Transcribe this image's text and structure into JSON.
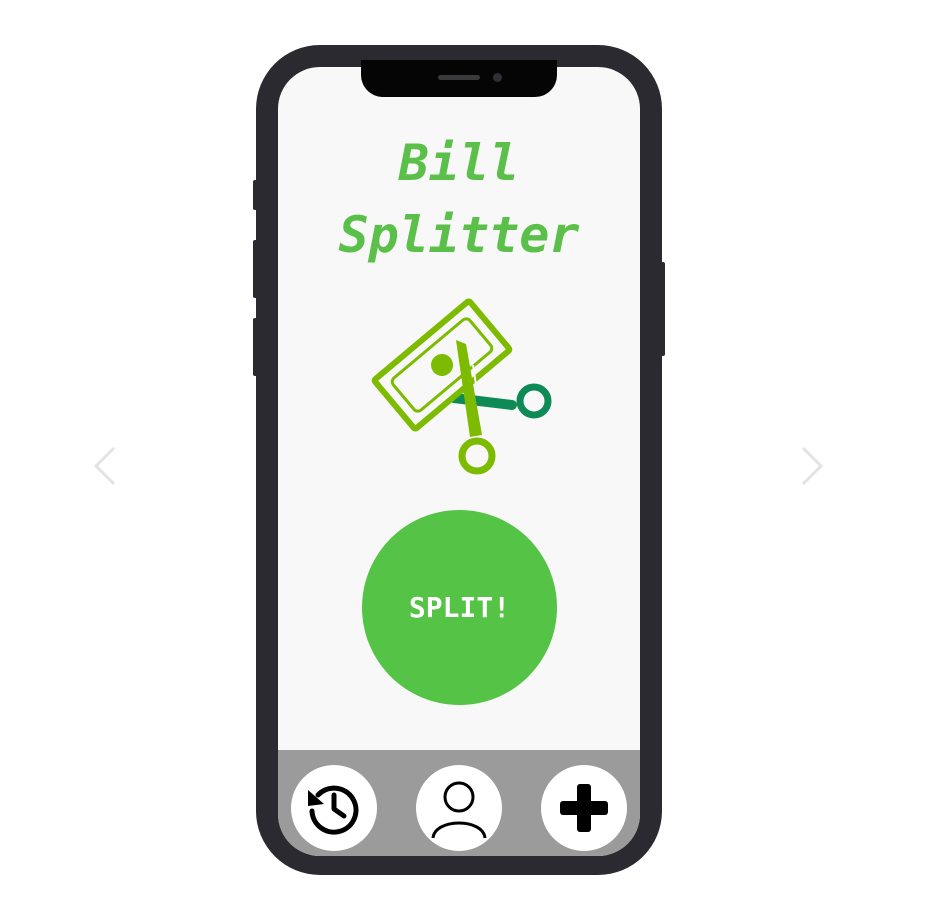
{
  "app": {
    "title_line1": "Bill",
    "title_line2": "Splitter",
    "split_label": "SPLIT!"
  },
  "icons": {
    "logo": "money-scissors-icon",
    "prev": "chevron-left-icon",
    "next": "chevron-right-icon",
    "history": "history-clock-icon",
    "profile": "user-profile-icon",
    "add": "plus-icon"
  },
  "colors": {
    "title_green": "#5bc04a",
    "button_green": "#55c345",
    "logo_lime": "#7dbb00",
    "logo_teal": "#0e8a57",
    "phone_frame": "#2b2a30",
    "bottom_bar": "#9b9b9b",
    "screen_bg": "#f8f8f8"
  }
}
